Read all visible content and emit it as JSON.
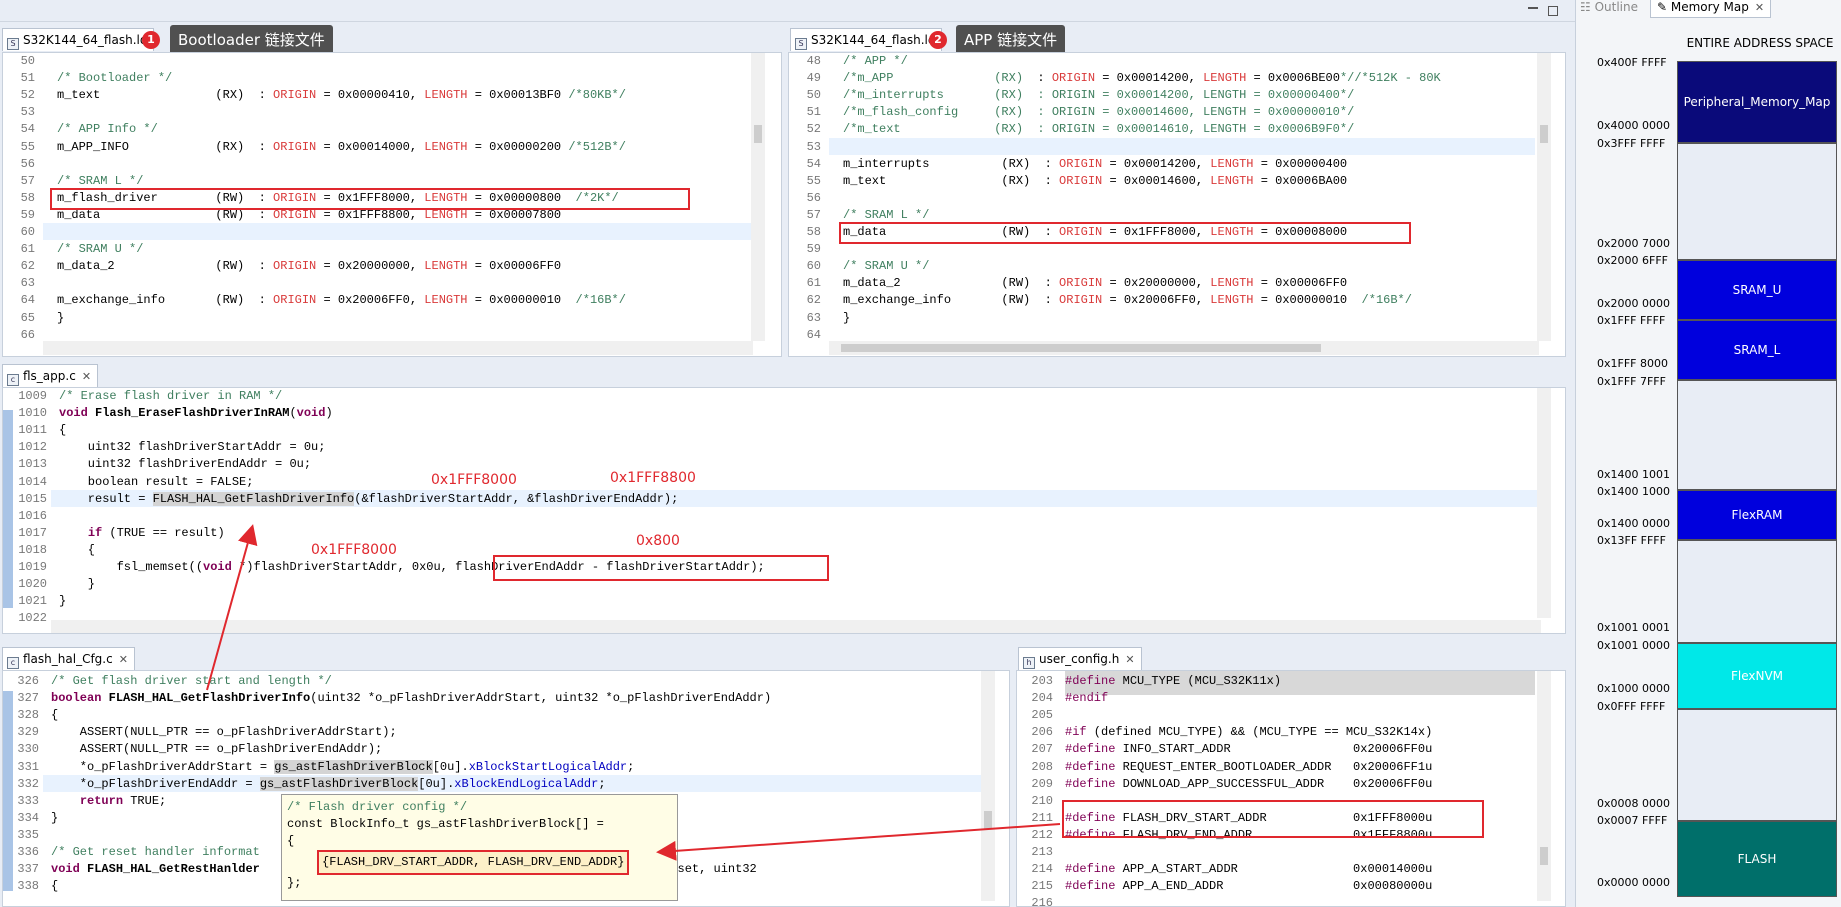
{
  "editors": {
    "top_left": {
      "tab": "S32K144_64_flash.ld",
      "callout": {
        "badge": "1",
        "text": "Bootloader 链接文件"
      },
      "lines": [
        {
          "n": "50",
          "html": ""
        },
        {
          "n": "51",
          "html": "<span class='c'>/* Bootloader */</span>"
        },
        {
          "n": "52",
          "html": "m_text                (RX)  : <span class='o'>ORIGIN</span> = 0x00000410, <span class='o'>LENGTH</span> = 0x00013BF0 <span class='c'>/*80KB*/</span>"
        },
        {
          "n": "53",
          "html": ""
        },
        {
          "n": "54",
          "html": "<span class='c'>/* APP Info */</span>"
        },
        {
          "n": "55",
          "html": "m_APP_INFO            (RX)  : <span class='o'>ORIGIN</span> = 0x00014000, <span class='o'>LENGTH</span> = 0x00000200 <span class='c'>/*512B*/</span>"
        },
        {
          "n": "56",
          "html": ""
        },
        {
          "n": "57",
          "html": "<span class='c'>/* SRAM L */</span>"
        },
        {
          "n": "58",
          "html": "m_flash_driver        (RW)  : <span class='o'>ORIGIN</span> = 0x1FFF8000, <span class='o'>LENGTH</span> = 0x00000800  <span class='c'>/*2K*/</span>"
        },
        {
          "n": "59",
          "html": "m_data                (RW)  : <span class='o'>ORIGIN</span> = 0x1FFF8800, <span class='o'>LENGTH</span> = 0x00007800"
        },
        {
          "n": "60",
          "html": ""
        },
        {
          "n": "61",
          "html": "<span class='c'>/* SRAM U */</span>"
        },
        {
          "n": "62",
          "html": "m_data_2              (RW)  : <span class='o'>ORIGIN</span> = 0x20000000, <span class='o'>LENGTH</span> = 0x00006FF0"
        },
        {
          "n": "63",
          "html": ""
        },
        {
          "n": "64",
          "html": "m_exchange_info       (RW)  : <span class='o'>ORIGIN</span> = 0x20006FF0, <span class='o'>LENGTH</span> = 0x00000010  <span class='c'>/*16B*/</span>"
        },
        {
          "n": "65",
          "html": "}"
        },
        {
          "n": "66",
          "html": ""
        }
      ]
    },
    "top_right": {
      "tab": "S32K144_64_flash.ld",
      "callout": {
        "badge": "2",
        "text": "APP 链接文件"
      },
      "lines": [
        {
          "n": "48",
          "html": "<span class='c'>/* APP */</span>"
        },
        {
          "n": "49",
          "html": "<span class='c'>/*m_APP              (RX)</span>  : <span class='o'>ORIGIN</span> = 0x00014200, <span class='o'>LENGTH</span> = 0x0006BE00<span class='c'>*//*512K - 80K</span>"
        },
        {
          "n": "50",
          "html": "<span class='c'>/*m_interrupts       (RX)  : ORIGIN = 0x00014200, LENGTH = 0x00000400*/</span>"
        },
        {
          "n": "51",
          "html": "<span class='c'>/*m_flash_config     (RX)  : ORIGIN = 0x00014600, LENGTH = 0x00000010*/</span>"
        },
        {
          "n": "52",
          "html": "<span class='c'>/*m_text             (RX)  : ORIGIN = 0x00014610, LENGTH = 0x0006B9F0*/</span>"
        },
        {
          "n": "53",
          "html": ""
        },
        {
          "n": "54",
          "html": "m_interrupts          (RX)  : <span class='o'>ORIGIN</span> = 0x00014200, <span class='o'>LENGTH</span> = 0x00000400"
        },
        {
          "n": "55",
          "html": "m_text                (RX)  : <span class='o'>ORIGIN</span> = 0x00014600, <span class='o'>LENGTH</span> = 0x0006BA00"
        },
        {
          "n": "56",
          "html": ""
        },
        {
          "n": "57",
          "html": "<span class='c'>/* SRAM L */</span>"
        },
        {
          "n": "58",
          "html": "m_data                (RW)  : <span class='o'>ORIGIN</span> = 0x1FFF8000, <span class='o'>LENGTH</span> = 0x00008000"
        },
        {
          "n": "59",
          "html": ""
        },
        {
          "n": "60",
          "html": "<span class='c'>/* SRAM U */</span>"
        },
        {
          "n": "61",
          "html": "m_data_2              (RW)  : <span class='o'>ORIGIN</span> = 0x20000000, <span class='o'>LENGTH</span> = 0x00006FF0"
        },
        {
          "n": "62",
          "html": "m_exchange_info       (RW)  : <span class='o'>ORIGIN</span> = 0x20006FF0, <span class='o'>LENGTH</span> = 0x00000010  <span class='c'>/*16B*/</span>"
        },
        {
          "n": "63",
          "html": "}"
        },
        {
          "n": "64",
          "html": ""
        }
      ]
    },
    "middle": {
      "tab": "fls_app.c",
      "lines": [
        {
          "n": "1009",
          "html": "<span class='c'>/* Erase flash driver in RAM */</span>"
        },
        {
          "n": "1010",
          "html": "<span class='k'>void</span> <span class='f'>Flash_EraseFlashDriverInRAM</span>(<span class='k'>void</span>)"
        },
        {
          "n": "1011",
          "html": "{"
        },
        {
          "n": "1012",
          "html": "    uint32 flashDriverStartAddr = 0u;"
        },
        {
          "n": "1013",
          "html": "    uint32 flashDriverEndAddr = 0u;"
        },
        {
          "n": "1014",
          "html": "    boolean result = FALSE;"
        },
        {
          "n": "1015",
          "html": "    result = <span style='background:#d4d4d4'>FLASH_HAL_GetFlashDriverInfo</span>(&amp;flashDriverStartAddr, &amp;flashDriverEndAddr);"
        },
        {
          "n": "1016",
          "html": ""
        },
        {
          "n": "1017",
          "html": "    <span class='k'>if</span> (TRUE == result)"
        },
        {
          "n": "1018",
          "html": "    {"
        },
        {
          "n": "1019",
          "html": "        fsl_memset((<span class='k'>void</span> *)flashDriverStartAddr, 0x0u, flashDriverEndAddr - flashDriverStartAddr);"
        },
        {
          "n": "1020",
          "html": "    }"
        },
        {
          "n": "1021",
          "html": "}"
        },
        {
          "n": "1022",
          "html": ""
        }
      ],
      "annotations": {
        "a1": "0x1FFF8000",
        "a2": "0x1FFF8800",
        "a3": "0x1FFF8000",
        "a4": "0x800"
      }
    },
    "bottom_left": {
      "tab": "flash_hal_Cfg.c",
      "lines": [
        {
          "n": "326",
          "html": "<span class='c'>/* Get flash driver start and length */</span>"
        },
        {
          "n": "327",
          "html": "<span class='k'>boolean</span> <span class='f'>FLASH_HAL_GetFlashDriverInfo</span>(uint32 *o_pFlashDriverAddrStart, uint32 *o_pFlashDriverEndAddr)"
        },
        {
          "n": "328",
          "html": "{"
        },
        {
          "n": "329",
          "html": "    ASSERT(NULL_PTR == o_pFlashDriverAddrStart);"
        },
        {
          "n": "330",
          "html": "    ASSERT(NULL_PTR == o_pFlashDriverEndAddr);"
        },
        {
          "n": "331",
          "html": "    *o_pFlashDriverAddrStart = <span style='background:#d4d4d4'>gs_astFlashDriverBlock</span>[0u].<span class='b'>xBlockStartLogicalAddr</span>;"
        },
        {
          "n": "332",
          "html": "    *o_pFlashDriverEndAddr = <span style='background:#d4d4d4'>gs_astFlashDriverBlock</span>[0u].<span class='b'>xBlockEndLogicalAddr</span>;"
        },
        {
          "n": "333",
          "html": "    <span class='k'>return</span> TRUE;"
        },
        {
          "n": "334",
          "html": "}"
        },
        {
          "n": "335",
          "html": ""
        },
        {
          "n": "336",
          "html": "<span class='c'>/* Get reset handler informat</span>"
        },
        {
          "n": "337",
          "html": "<span class='k'>void</span> <span class='f'>FLASH_HAL_GetRestHanlder</span>                                 uint32 *o_pResetHanderOffset, uint32"
        },
        {
          "n": "338",
          "html": "{"
        }
      ],
      "tooltip": {
        "l1": "/* Flash driver config */",
        "l2": "const BlockInfo_t gs_astFlashDriverBlock[] =",
        "l3": "{",
        "l4": "{FLASH_DRV_START_ADDR, FLASH_DRV_END_ADDR}",
        "l5": "};"
      }
    },
    "bottom_right": {
      "tab": "user_config.h",
      "lines": [
        {
          "n": "203",
          "html": "<span class='d'>#define</span> MCU_TYPE (MCU_S32K11x)"
        },
        {
          "n": "204",
          "html": "<span class='d'>#endif</span>"
        },
        {
          "n": "205",
          "html": ""
        },
        {
          "n": "206",
          "html": "<span class='d'>#if</span> (defined MCU_TYPE) &amp;&amp; (MCU_TYPE == MCU_S32K14x)"
        },
        {
          "n": "207",
          "html": "<span class='d'>#define</span> INFO_START_ADDR                 0x20006FF0u"
        },
        {
          "n": "208",
          "html": "<span class='d'>#define</span> REQUEST_ENTER_BOOTLOADER_ADDR   0x20006FF1u"
        },
        {
          "n": "209",
          "html": "<span class='d'>#define</span> DOWNLOAD_APP_SUCCESSFUL_ADDR    0x20006FF0u"
        },
        {
          "n": "210",
          "html": ""
        },
        {
          "n": "211",
          "html": "<span class='d'>#define</span> FLASH_DRV_START_ADDR            0x1FFF8000u"
        },
        {
          "n": "212",
          "html": "<span class='d'>#define</span> FLASH_DRV_END_ADDR              0x1FFF8800u"
        },
        {
          "n": "213",
          "html": ""
        },
        {
          "n": "214",
          "html": "<span class='d'>#define</span> APP_A_START_ADDR                0x00014000u"
        },
        {
          "n": "215",
          "html": "<span class='d'>#define</span> APP_A_END_ADDR                  0x00080000u"
        },
        {
          "n": "216",
          "html": ""
        }
      ]
    }
  },
  "memory_map": {
    "tabs": {
      "outline": "Outline",
      "memory_map": "Memory Map"
    },
    "heading": "ENTIRE ADDRESS SPACE",
    "addresses": [
      "0x400F FFFF",
      "0x4000 0000",
      "0x3FFF FFFF",
      "0x2000 7000",
      "0x2000 6FFF",
      "0x2000 0000",
      "0x1FFF FFFF",
      "0x1FFF 8000",
      "0x1FFF 7FFF",
      "0x1400 1001",
      "0x1400 1000",
      "0x1400 0000",
      "0x13FF FFFF",
      "0x1001 0001",
      "0x1001 0000",
      "0x1000 0000",
      "0x0FFF FFFF",
      "0x0008 0000",
      "0x0007 FFFF",
      "0x0000 0000"
    ],
    "blocks": {
      "peripheral": "Peripheral_Memory_Map",
      "sram_u": "SRAM_U",
      "sram_l": "SRAM_L",
      "flexram": "FlexRAM",
      "flexnvm": "FlexNVM",
      "flash": "FLASH"
    },
    "colors": {
      "peripheral": "#0a0a7a",
      "sram": "#0000dd",
      "flexnvm": "#00e8e8",
      "flash": "#006f6a",
      "empty": "#e8edf5"
    }
  }
}
